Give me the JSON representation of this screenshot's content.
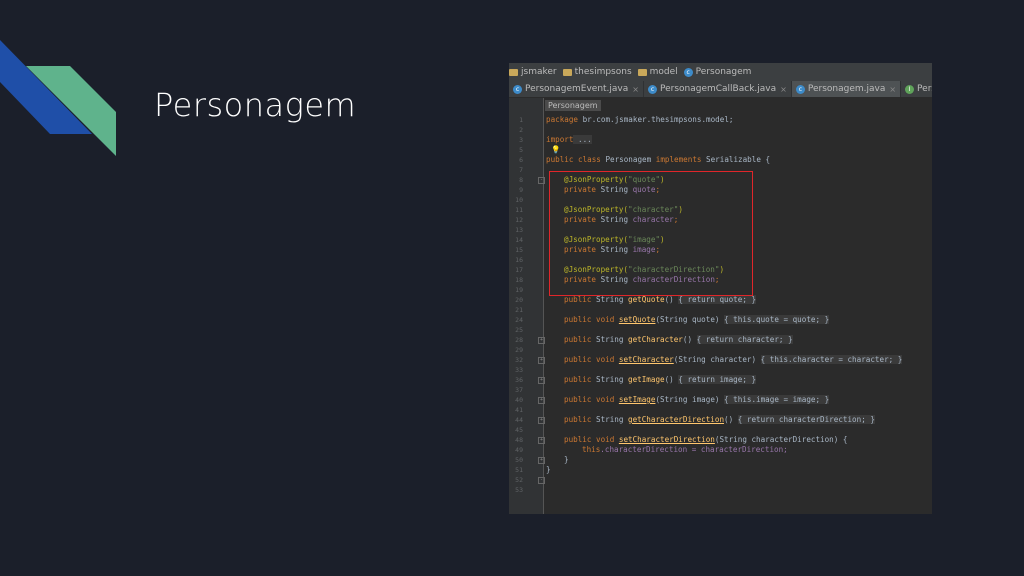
{
  "slide": {
    "title": "Personagem"
  },
  "colors": {
    "background": "#1b1f2a",
    "deco_blue": "#1f4fa8",
    "deco_green": "#5fb38c",
    "highlight": "#e0262a"
  },
  "navbar": {
    "items": [
      {
        "label": "jsmaker",
        "icon": "folder-icon"
      },
      {
        "label": "thesimpsons",
        "icon": "folder-icon"
      },
      {
        "label": "model",
        "icon": "folder-icon"
      },
      {
        "label": "Personagem",
        "icon": "class-icon"
      }
    ]
  },
  "tabs": [
    {
      "label": "PersonagemEvent.java",
      "close": "×",
      "icon": "class-icon"
    },
    {
      "label": "PersonagemCallBack.java",
      "close": "×",
      "icon": "class-icon"
    },
    {
      "label": "Personagem.java",
      "close": "×",
      "icon": "class-icon",
      "active": true
    },
    {
      "label": "PersonagemSe",
      "close": "",
      "icon": "interface-icon"
    }
  ],
  "editor": {
    "breadcrumb": "Personagem",
    "line_numbers": [
      "1",
      "2",
      "3",
      "5",
      "6",
      "7",
      "8",
      "9",
      "10",
      "11",
      "12",
      "13",
      "14",
      "15",
      "16",
      "17",
      "18",
      "19",
      "20",
      "21",
      "24",
      "25",
      "28",
      "29",
      "32",
      "33",
      "36",
      "37",
      "40",
      "41",
      "44",
      "45",
      "48",
      "49",
      "50",
      "51",
      "52",
      "53"
    ],
    "code": {
      "package_kw": "package",
      "package_name": " br.com.jsmaker.thesimpsons.model;",
      "import_kw": "import",
      "import_dots": " ...",
      "class_kw": "public class",
      "class_name": " Personagem ",
      "implements_kw": "implements",
      "serializable": " Serializable {",
      "ann1": "@JsonProperty(",
      "str_quote": "\"quote\"",
      "close_paren": ")",
      "priv": "private",
      "string_t": " String ",
      "f_quote": "quote",
      "semi": ";",
      "str_character": "\"character\"",
      "f_character": "character",
      "str_image": "\"image\"",
      "f_image": "image",
      "str_chardir": "\"characterDirection\"",
      "f_chardir": "characterDirection",
      "pub": "public",
      "void_t": " void ",
      "m_getQuote": "getQuote",
      "m_setQuote": "setQuote",
      "m_getCharacter": "getCharacter",
      "m_setCharacter": "setCharacter",
      "m_getImage": "getImage",
      "m_setImage": "setImage",
      "m_getCharDir": "getCharacterDirection",
      "m_setCharDir": "setCharacterDirection",
      "empty_params": "() ",
      "ret": "return",
      "this_kw": "this",
      "p_setQuote": "(String quote) ",
      "p_setCharacter": "(String character) ",
      "p_setImage": "(String image) ",
      "p_setCharDir": "(String characterDirection) {",
      "body_getQuote": "{ return quote; }",
      "body_setQuote": "{ this.quote = quote; }",
      "body_getCharacter": "{ return character; }",
      "body_setCharacter": "{ this.character = character; }",
      "body_getImage": "{ return image; }",
      "body_setImage": "{ this.image = image; }",
      "body_getCharDir": "{ return characterDirection; }",
      "assign_chardir": ".characterDirection = characterDirection;",
      "close_brace": "}"
    }
  }
}
